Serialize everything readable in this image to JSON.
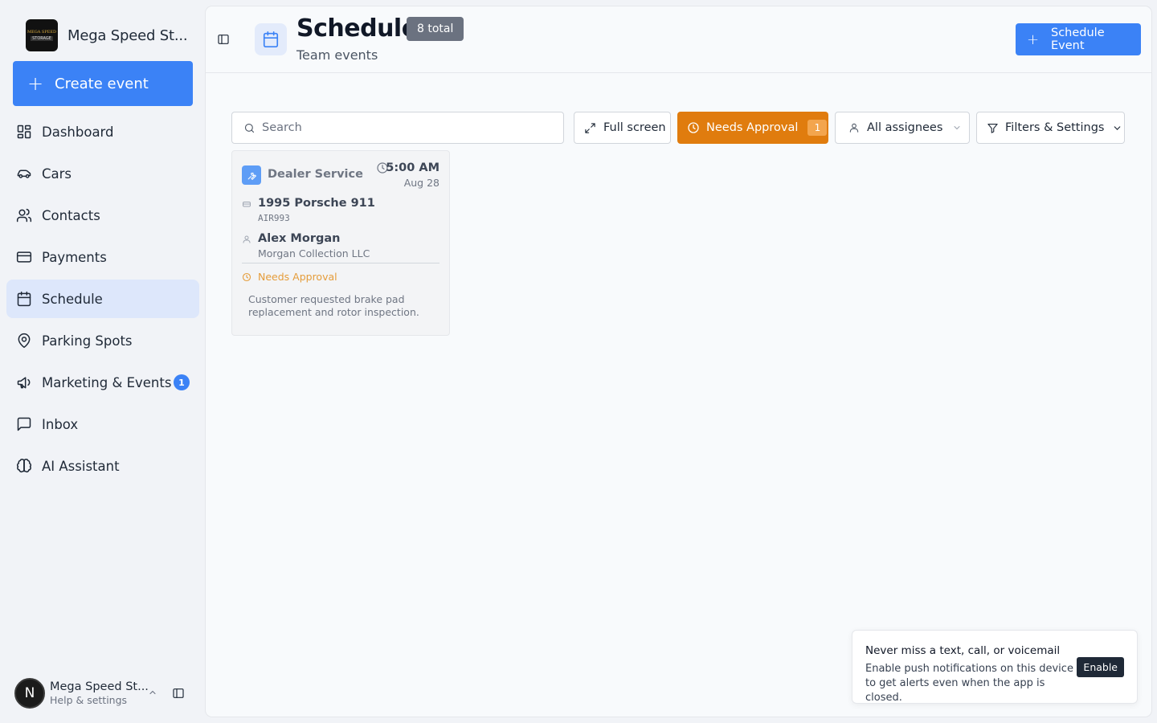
{
  "sidebar": {
    "brand": {
      "name": "Mega Speed St...",
      "logo_line1": "MEGA SPEED",
      "logo_line2": "STORAGE"
    },
    "create_event_label": "Create event",
    "items": [
      {
        "label": "Dashboard",
        "icon": "dashboard-icon"
      },
      {
        "label": "Cars",
        "icon": "car-icon"
      },
      {
        "label": "Contacts",
        "icon": "users-icon"
      },
      {
        "label": "Payments",
        "icon": "credit-card-icon"
      },
      {
        "label": "Schedule",
        "icon": "calendar-icon",
        "active": true
      },
      {
        "label": "Parking Spots",
        "icon": "map-pin-icon"
      },
      {
        "label": "Marketing & Events",
        "icon": "megaphone-icon",
        "badge": "1"
      },
      {
        "label": "Inbox",
        "icon": "message-square-icon"
      },
      {
        "label": "AI Assistant",
        "icon": "brain-icon"
      }
    ],
    "account": {
      "avatar_letter": "N",
      "name": "Mega Speed St...",
      "sub": "Help & settings"
    }
  },
  "header": {
    "title": "Schedule",
    "count_badge": "8 total",
    "subtitle": "Team events",
    "schedule_button_label": "Schedule Event"
  },
  "toolbar": {
    "search_placeholder": "Search",
    "search_value": "",
    "fullscreen_label": "Full screen",
    "needs_approval_label": "Needs Approval",
    "needs_approval_count": "1",
    "assignees_label": "All assignees",
    "filters_label": "Filters & Settings"
  },
  "events": [
    {
      "service": "Dealer Service",
      "time": "5:00 AM",
      "date": "Aug 28",
      "car": "1995 Porsche 911",
      "plate": "AIR993",
      "person": "Alex Morgan",
      "company": "Morgan Collection LLC",
      "status": "Needs Approval",
      "note": "Customer requested brake pad replacement and rotor inspection."
    }
  ],
  "toast": {
    "title": "Never miss a text, call, or voicemail",
    "body": "Enable push notifications on this device to get alerts even when the app is closed.",
    "button_label": "Enable"
  },
  "colors": {
    "accent": "#3b82f6",
    "approval": "#e07c0e",
    "active_nav": "#dde7fb",
    "status_pending": "#e59a35"
  }
}
